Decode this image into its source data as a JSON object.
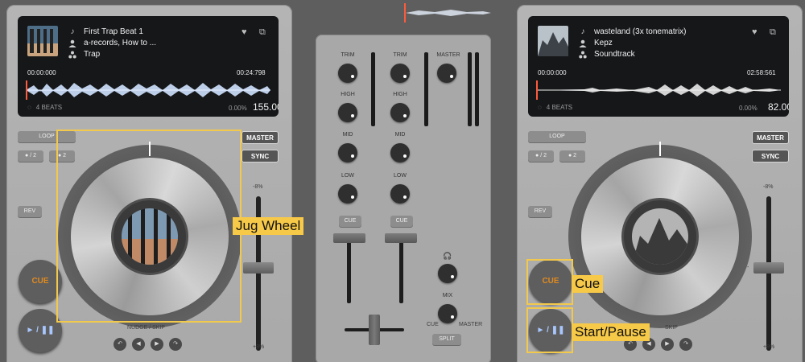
{
  "deck_a": {
    "title": "First Trap Beat 1",
    "artist": "a-records, How to ...",
    "genre": "Trap",
    "time_elapsed": "00:00:000",
    "time_remaining": "00:24:798",
    "beats": "4 BEATS",
    "pitch_pct": "0.00%",
    "bpm": "155.00",
    "loop": "LOOP",
    "half": "● / 2",
    "double": "● 2",
    "master": "MASTER",
    "sync": "SYNC",
    "rev": "REV",
    "cue": "CUE",
    "play": "► / ❚❚",
    "nudge_skip": "NUDGE / SKIP",
    "pitch_top": "-8%",
    "pitch_bottom": "+8%"
  },
  "deck_b": {
    "title": "wasteland (3x tonematrix)",
    "artist": "Kepz",
    "genre": "Soundtrack",
    "time_elapsed": "00:00:000",
    "time_remaining": "02:58:561",
    "beats": "4 BEATS",
    "pitch_pct": "0.00%",
    "bpm": "82.00",
    "loop": "LOOP",
    "half": "● / 2",
    "double": "● 2",
    "master": "MASTER",
    "sync": "SYNC",
    "rev": "REV",
    "cue": "CUE",
    "play": "► / ❚❚",
    "nudge_skip": "SKIP",
    "pitch_top": "-8%",
    "pitch_bottom": "+8%",
    "pitch_mid": "-"
  },
  "mixer": {
    "trim": "TRIM",
    "high": "HIGH",
    "mid": "MID",
    "low": "LOW",
    "cue": "CUE",
    "master": "MASTER",
    "mix": "MIX",
    "mix_cue": "CUE",
    "mix_master": "MASTER",
    "split": "SPLIT",
    "headphones_icon": "🎧"
  },
  "icons": {
    "note": "♪",
    "person": "👤",
    "genre": "⁂",
    "heart": "♥",
    "external": "⧉",
    "beats": "◌"
  },
  "annotations": {
    "jug_wheel": "Jug Wheel",
    "cue": "Cue",
    "start_pause": "Start/Pause"
  },
  "colors": {
    "highlight": "#f7c948",
    "cue_text": "#e08a1e",
    "play_text": "#a9c7ff",
    "playhead": "#ff5a3c"
  }
}
